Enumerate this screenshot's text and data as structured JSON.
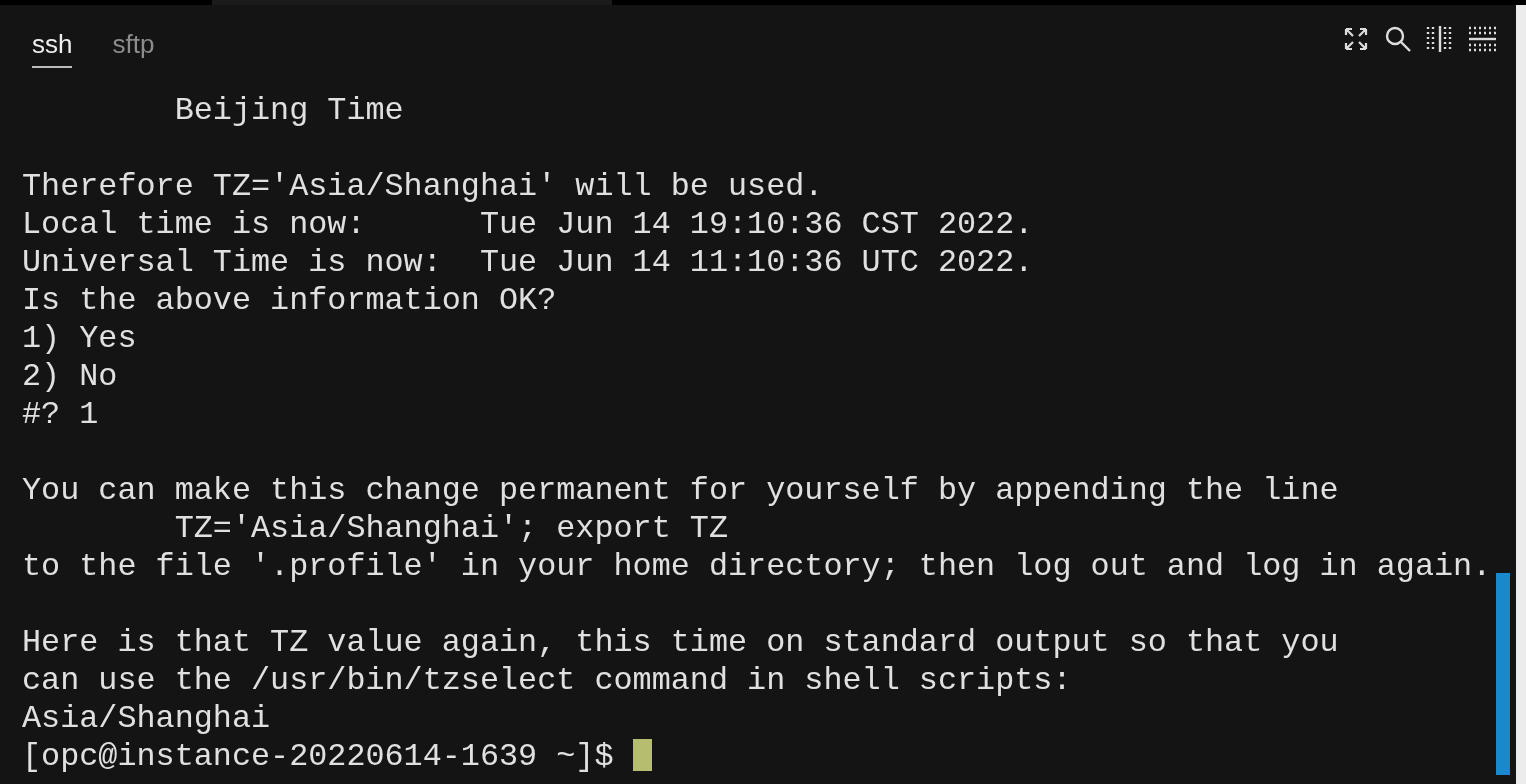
{
  "tabs": [
    {
      "label": "ssh",
      "selected": true
    },
    {
      "label": "sftp",
      "selected": false
    }
  ],
  "terminal": {
    "lines": [
      {
        "kind": "line",
        "text": "        Beijing Time"
      },
      {
        "kind": "blank"
      },
      {
        "kind": "line",
        "text": "Therefore TZ='Asia/Shanghai' will be used."
      },
      {
        "kind": "line",
        "text": "Local time is now:      Tue Jun 14 19:10:36 CST 2022."
      },
      {
        "kind": "line",
        "text": "Universal Time is now:  Tue Jun 14 11:10:36 UTC 2022."
      },
      {
        "kind": "line",
        "text": "Is the above information OK?"
      },
      {
        "kind": "line",
        "text": "1) Yes"
      },
      {
        "kind": "line",
        "text": "2) No"
      },
      {
        "kind": "line",
        "text": "#? 1"
      },
      {
        "kind": "blank"
      },
      {
        "kind": "line",
        "text": "You can make this change permanent for yourself by appending the line"
      },
      {
        "kind": "line",
        "text": "        TZ='Asia/Shanghai'; export TZ"
      },
      {
        "kind": "line",
        "text": "to the file '.profile' in your home directory; then log out and log in again."
      },
      {
        "kind": "blank"
      },
      {
        "kind": "line",
        "text": "Here is that TZ value again, this time on standard output so that you"
      },
      {
        "kind": "line",
        "text": "can use the /usr/bin/tzselect command in shell scripts:"
      },
      {
        "kind": "line",
        "text": "Asia/Shanghai"
      },
      {
        "kind": "prompt",
        "text": "[opc@instance-20220614-1639 ~]$ "
      }
    ]
  }
}
